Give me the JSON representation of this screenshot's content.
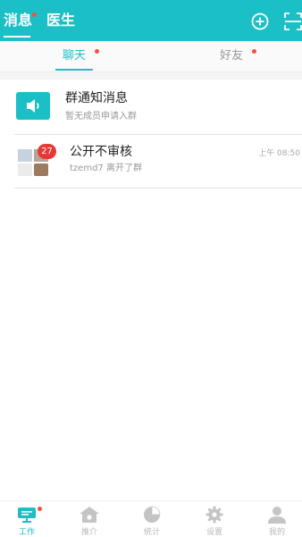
{
  "colors": {
    "accent": "#1bbfc6",
    "badge": "#e53935",
    "dot": "#f0523c",
    "muted": "#b8b8b8"
  },
  "header": {
    "tabs": [
      {
        "label": "消息"
      },
      {
        "label": "医生"
      }
    ],
    "icons": [
      "plus-circle-icon",
      "scan-icon"
    ]
  },
  "segment": {
    "tabs": [
      {
        "label": "聊天"
      },
      {
        "label": "好友"
      }
    ]
  },
  "list": [
    {
      "title": "群通知消息",
      "subtitle": "暂无成员申请入群",
      "icon": "speaker-icon"
    },
    {
      "title": "公开不审核",
      "subtitle": "tzemd7 离开了群",
      "time": "上午 08:50",
      "badge": "27",
      "icon": "group-avatar"
    }
  ],
  "bottom_nav": [
    {
      "label": "工作",
      "icon": "work-chat-icon"
    },
    {
      "label": "推介",
      "icon": "home-icon"
    },
    {
      "label": "统计",
      "icon": "pie-chart-icon"
    },
    {
      "label": "设置",
      "icon": "gear-icon"
    },
    {
      "label": "我的",
      "icon": "person-icon"
    }
  ]
}
